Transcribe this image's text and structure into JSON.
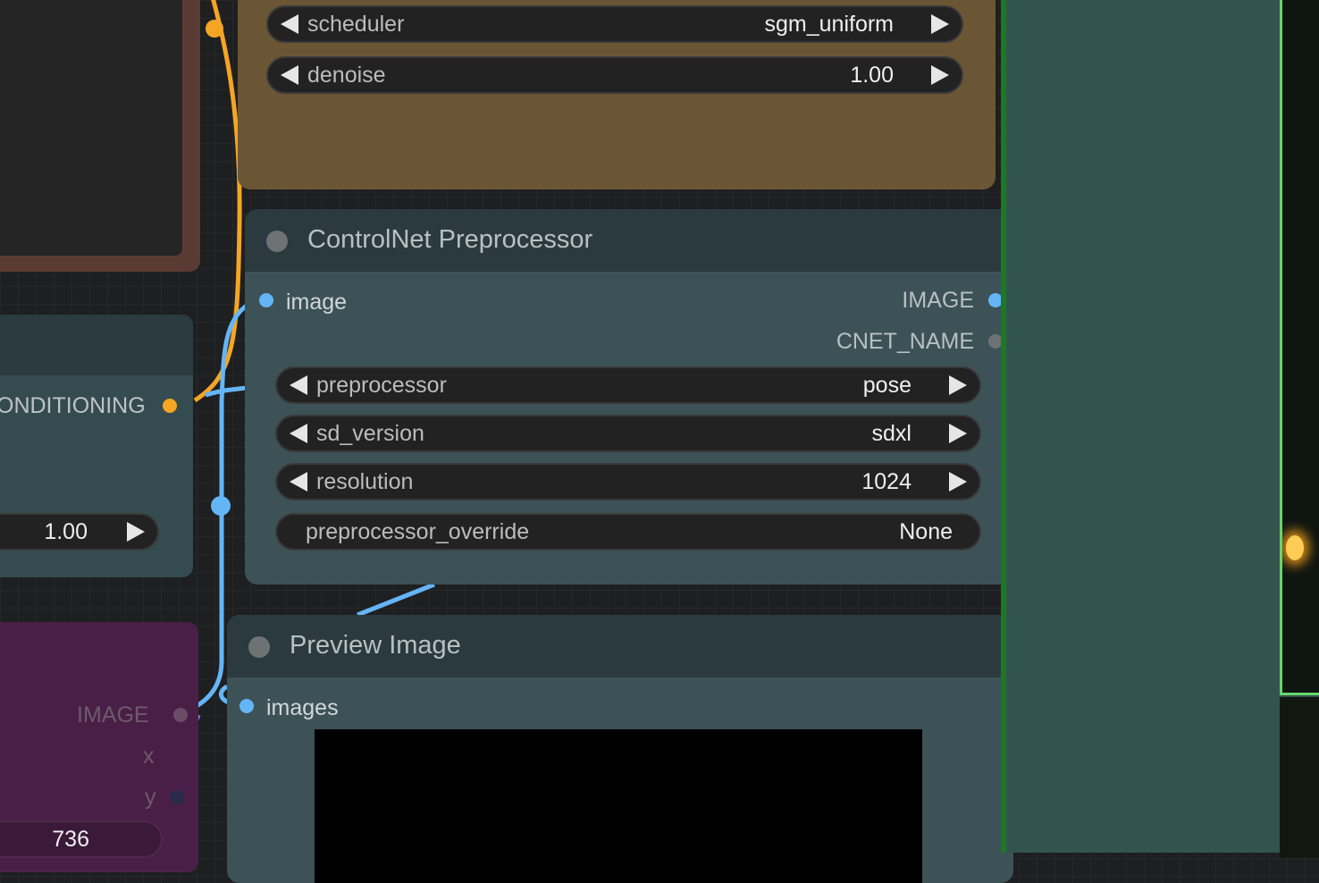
{
  "ksampler": {
    "widgets": [
      {
        "label": "scheduler",
        "value": "sgm_uniform"
      },
      {
        "label": "denoise",
        "value": "1.00"
      }
    ]
  },
  "left_nodes": {
    "conditioning_output": "ONDITIONING",
    "strength_value": "1.00",
    "purple_outputs": [
      "IMAGE",
      "x",
      "y"
    ],
    "purple_value": "736"
  },
  "controlnet": {
    "title": "ControlNet Preprocessor",
    "input": "image",
    "outputs": [
      "IMAGE",
      "CNET_NAME"
    ],
    "widgets": [
      {
        "label": "preprocessor",
        "value": "pose"
      },
      {
        "label": "sd_version",
        "value": "sdxl"
      },
      {
        "label": "resolution",
        "value": "1024"
      }
    ],
    "override": {
      "label": "preprocessor_override",
      "value": "None"
    }
  },
  "preview": {
    "title": "Preview Image",
    "input": "images"
  },
  "colors": {
    "conditioning": "#f5a524",
    "image": "#64b5f6",
    "latent": "#8b7fe8"
  }
}
